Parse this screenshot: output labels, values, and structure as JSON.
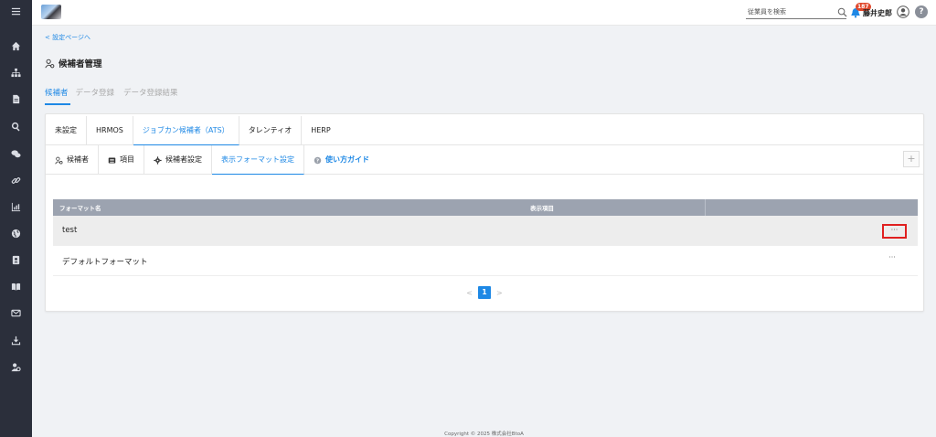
{
  "sidebar": {
    "icons": [
      "menu-icon",
      "home-icon",
      "org-chart-icon",
      "document-icon",
      "search-icon",
      "chat-icon",
      "link-icon",
      "chart-icon",
      "globe-icon",
      "contact-card-icon",
      "book-icon",
      "mail-icon",
      "download-icon",
      "user-settings-icon"
    ]
  },
  "header": {
    "search_placeholder": "従業員を検索",
    "notification_count": "187",
    "user_name": "藤井史郎"
  },
  "breadcrumb": {
    "back_label": "設定ページへ"
  },
  "page": {
    "title": "候補者管理"
  },
  "main_tabs": [
    {
      "label": "候補者",
      "active": true
    },
    {
      "label": "データ登録",
      "active": false
    },
    {
      "label": "データ登録結果",
      "active": false
    }
  ],
  "ats_tabs": [
    {
      "label": "未設定"
    },
    {
      "label": "HRMOS"
    },
    {
      "label": "ジョブカン候補者（ATS）",
      "active": true
    },
    {
      "label": "タレンティオ"
    },
    {
      "label": "HERP"
    }
  ],
  "sub_tabs": [
    {
      "label": "候補者",
      "icon": "user-gear-icon"
    },
    {
      "label": "項目",
      "icon": "list-icon"
    },
    {
      "label": "候補者設定",
      "icon": "gear-icon"
    },
    {
      "label": "表示フォーマット設定",
      "active": true
    },
    {
      "label": "使い方ガイド",
      "icon": "question-circle-icon"
    }
  ],
  "add_button_label": "+",
  "table": {
    "headers": [
      "フォーマット名",
      "表示項目"
    ],
    "rows": [
      {
        "name": "test",
        "more": "···"
      },
      {
        "name": "デフォルトフォーマット",
        "more": "···"
      }
    ]
  },
  "pagination": {
    "prev": "<",
    "current": "1",
    "next": ">"
  },
  "footer": {
    "text": "Copyright © 2025 株式会社BtoA"
  },
  "colors": {
    "accent": "#1e88e5",
    "sidebar_bg": "#2b2f3b",
    "header_bg": "#9ca3b0",
    "highlight_box": "#e02020"
  }
}
